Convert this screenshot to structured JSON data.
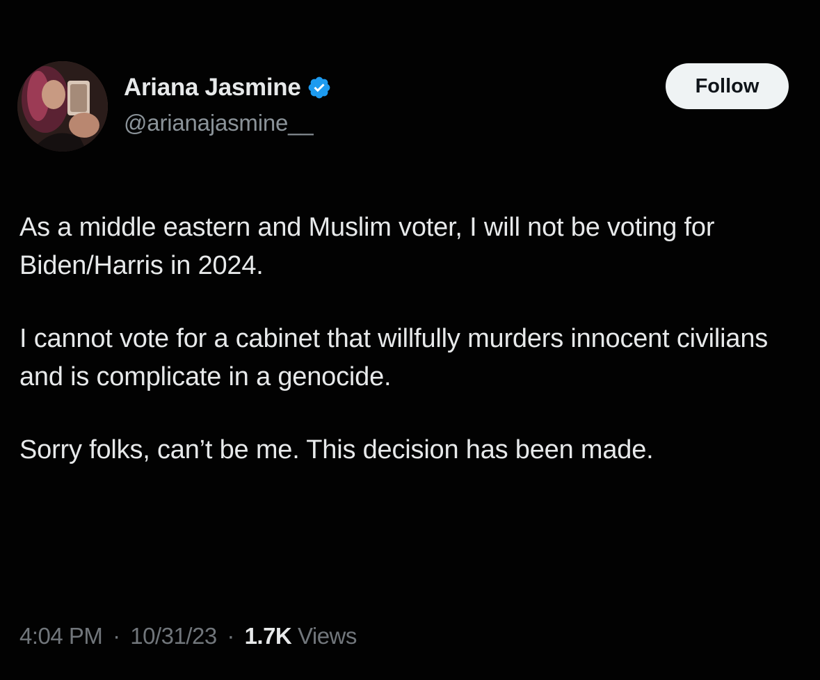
{
  "tweet": {
    "author": {
      "display_name": "Ariana Jasmine",
      "handle": "@arianajasmine__",
      "verified": true,
      "verified_color": "#1d9bf0"
    },
    "follow_label": "Follow",
    "paragraphs": [
      "As a middle eastern and Muslim voter, I will not be voting for Biden/Harris in 2024.",
      "I cannot vote for a cabinet that willfully murders innocent civilians and is complicate in a genocide.",
      "Sorry folks, can’t be me. This decision has been made."
    ],
    "time": "4:04 PM",
    "date": "10/31/23",
    "separator": "·",
    "views_count": "1.7K",
    "views_label": "Views"
  },
  "colors": {
    "background": "#000000",
    "text_primary": "#e7e9ea",
    "text_secondary": "#71767b",
    "follow_button_bg": "#eff3f4"
  },
  "icons": {
    "verified": "verified-badge-icon"
  }
}
